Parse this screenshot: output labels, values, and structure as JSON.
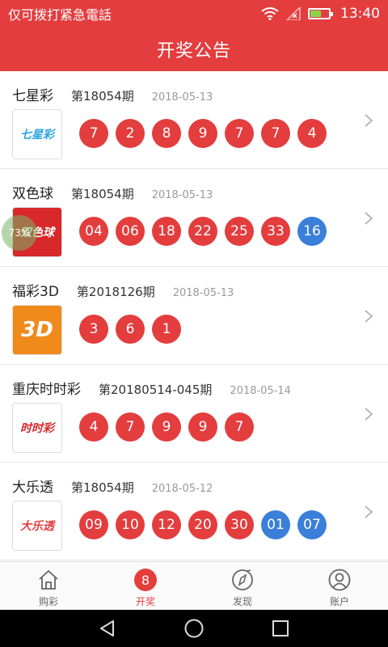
{
  "status": {
    "carrier": "仅可拨打紧急電話",
    "time": "13:40"
  },
  "title": "开奖公告",
  "lotteries": [
    {
      "name": "七星彩",
      "issue": "第18054期",
      "date": "2018-05-13",
      "logo_text": "七星彩",
      "numbers": [
        "7",
        "2",
        "8",
        "9",
        "7",
        "7",
        "4"
      ],
      "blue": []
    },
    {
      "name": "双色球",
      "issue": "第18054期",
      "date": "2018-05-13",
      "logo_text": "双色球",
      "numbers": [
        "04",
        "06",
        "18",
        "22",
        "25",
        "33"
      ],
      "blue": [
        "16"
      ]
    },
    {
      "name": "福彩3D",
      "issue": "第2018126期",
      "date": "2018-05-13",
      "logo_text": "3D",
      "numbers": [
        "3",
        "6",
        "1"
      ],
      "blue": []
    },
    {
      "name": "重庆时时彩",
      "issue": "第20180514-045期",
      "date": "2018-05-14",
      "logo_text": "时时彩",
      "numbers": [
        "4",
        "7",
        "9",
        "9",
        "7"
      ],
      "blue": []
    },
    {
      "name": "大乐透",
      "issue": "第18054期",
      "date": "2018-05-12",
      "logo_text": "大乐透",
      "numbers": [
        "09",
        "10",
        "12",
        "20",
        "30"
      ],
      "blue": [
        "01",
        "07"
      ]
    }
  ],
  "float_badge": "73%",
  "tabs": [
    {
      "label": "购彩",
      "icon": "home-icon"
    },
    {
      "label": "开奖",
      "icon": "draw-badge",
      "badge": "8",
      "active": true
    },
    {
      "label": "发现",
      "icon": "compass-icon"
    },
    {
      "label": "账户",
      "icon": "user-icon"
    }
  ],
  "colors": {
    "primary": "#e33d3e",
    "blue_ball": "#3a7fd8"
  }
}
